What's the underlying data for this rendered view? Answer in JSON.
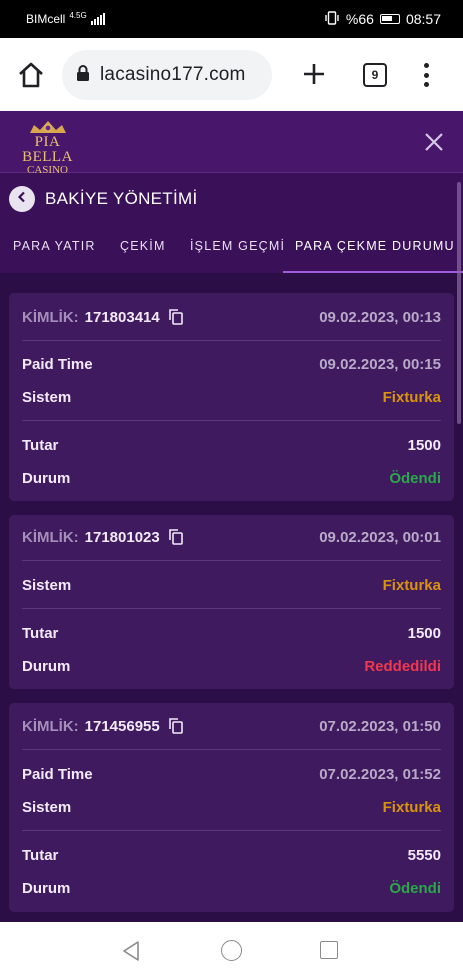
{
  "status_bar": {
    "carrier": "BIMcell",
    "network": "4.5G",
    "battery": "%66",
    "time": "08:57"
  },
  "browser": {
    "url": "lacasino177.com",
    "tab_count": "9"
  },
  "site": {
    "logo_name": "PIA BELLA",
    "logo_sub": "CASINO"
  },
  "page": {
    "title": "BAKİYE YÖNETİMİ",
    "tabs": [
      {
        "label": "PARA YATIR"
      },
      {
        "label": "ÇEKİM"
      },
      {
        "label": "İŞLEM GEÇMİ"
      },
      {
        "label": "PARA ÇEKME DURUMU"
      }
    ],
    "active_tab": 3
  },
  "labels": {
    "id": "KİMLİK:",
    "paid_time": "Paid Time",
    "system": "Sistem",
    "amount": "Tutar",
    "status": "Durum"
  },
  "withdrawals": [
    {
      "id": "171803414",
      "date": "09.02.2023, 00:13",
      "paid_time": "09.02.2023, 00:15",
      "system": "Fixturka",
      "amount": "1500",
      "status": "Ödendi"
    },
    {
      "id": "171801023",
      "date": "09.02.2023, 00:01",
      "system": "Fixturka",
      "amount": "1500",
      "status": "Reddedildi"
    },
    {
      "id": "171456955",
      "date": "07.02.2023, 01:50",
      "paid_time": "07.02.2023, 01:52",
      "system": "Fixturka",
      "amount": "5550",
      "status": "Ödendi"
    }
  ],
  "colors": {
    "status_paid": "#2aa84a",
    "status_rejected": "#f0384f",
    "system": "#d9940d",
    "header": "#48166b"
  }
}
